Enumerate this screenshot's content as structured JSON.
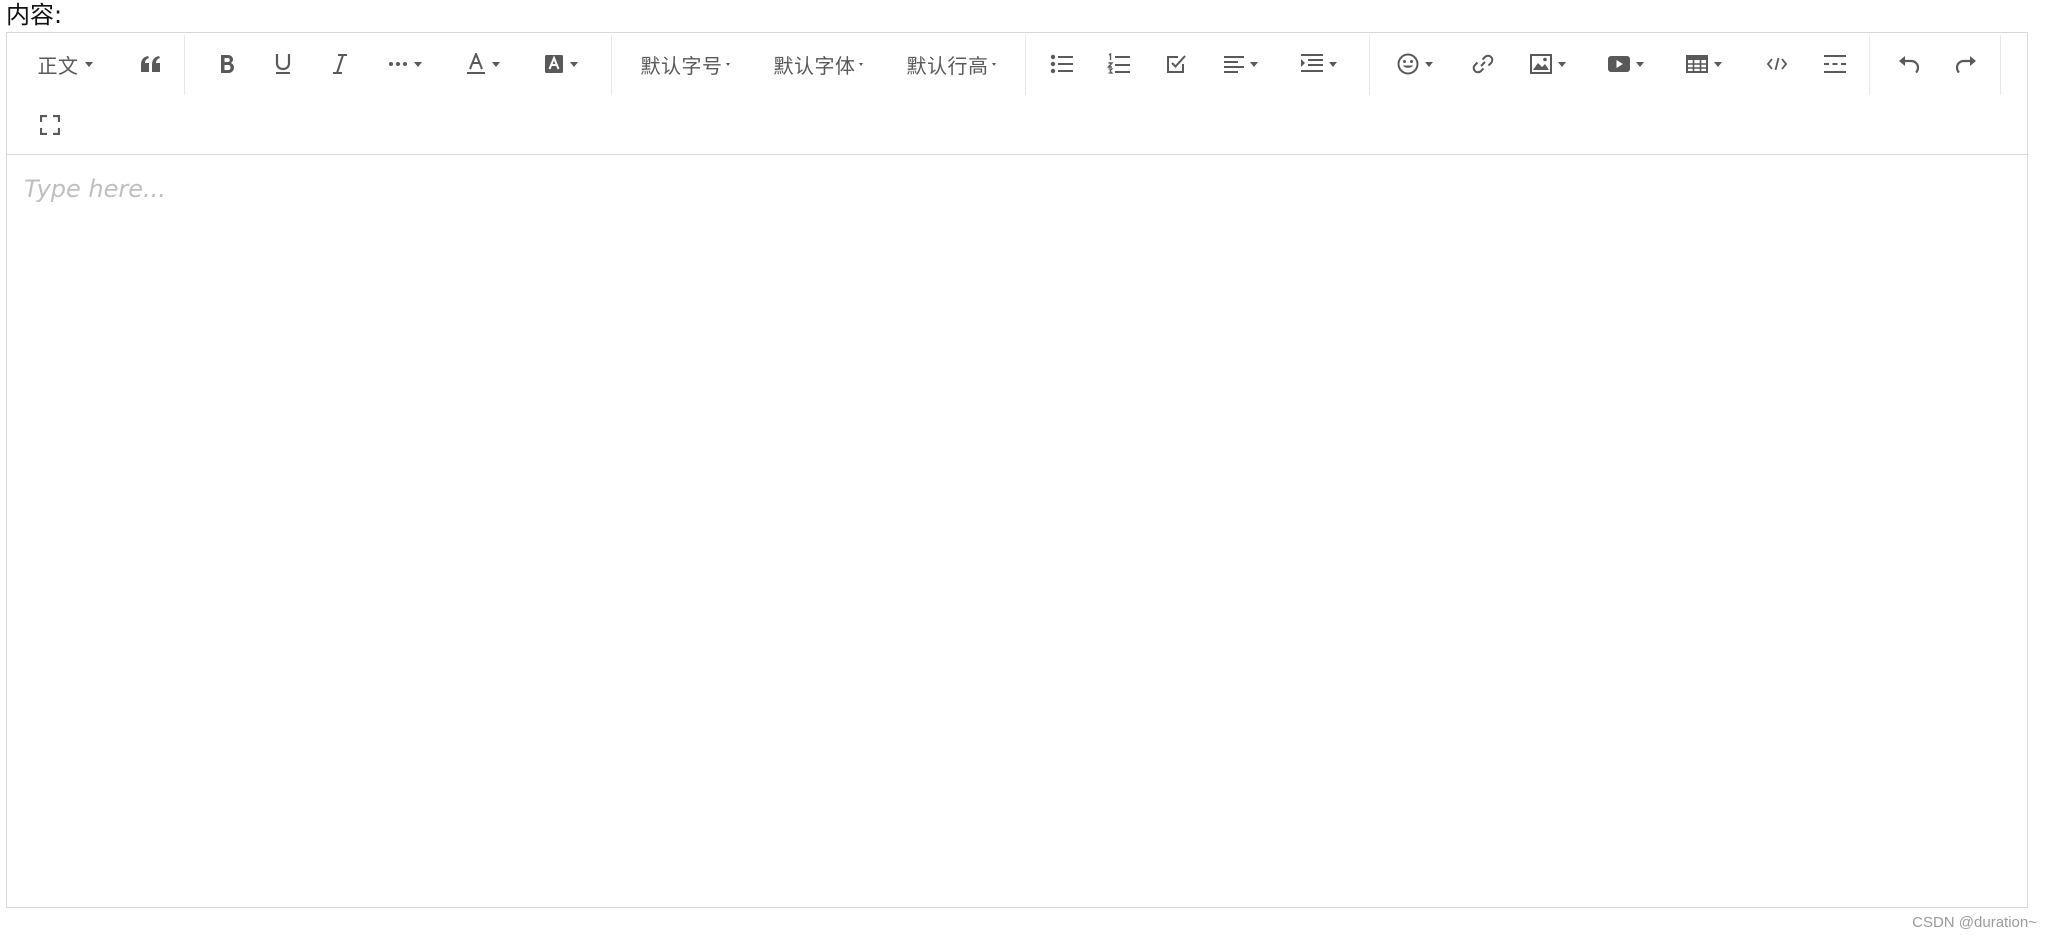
{
  "label": "内容:",
  "toolbar": {
    "heading": "正文",
    "font_size": "默认字号",
    "font_family": "默认字体",
    "line_height": "默认行高"
  },
  "editor": {
    "placeholder": "Type here..."
  },
  "watermark": "CSDN @duration~"
}
